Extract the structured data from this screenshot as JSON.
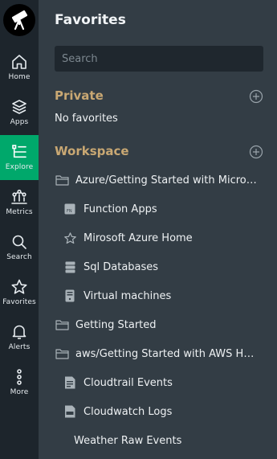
{
  "nav": {
    "items": [
      {
        "label": "Home",
        "icon": "home-icon"
      },
      {
        "label": "Apps",
        "icon": "apps-icon"
      },
      {
        "label": "Explore",
        "icon": "explore-icon",
        "active": true
      },
      {
        "label": "Metrics",
        "icon": "metrics-icon"
      },
      {
        "label": "Search",
        "icon": "search-icon"
      },
      {
        "label": "Favorites",
        "icon": "star-icon"
      },
      {
        "label": "Alerts",
        "icon": "bell-icon"
      },
      {
        "label": "More",
        "icon": "more-icon"
      }
    ]
  },
  "panel": {
    "title": "Favorites",
    "search_placeholder": "Search",
    "private": {
      "label": "Private",
      "empty_text": "No favorites"
    },
    "workspace": {
      "label": "Workspace",
      "items": [
        {
          "label": "Azure/Getting Started with Microsoft Azure",
          "icon": "folder-icon"
        },
        {
          "label": "Function Apps",
          "icon": "fn-dashboard-icon"
        },
        {
          "label": "Mirosoft Azure Home",
          "icon": "star-outline-icon"
        },
        {
          "label": "Sql Databases",
          "icon": "database-icon"
        },
        {
          "label": "Virtual machines",
          "icon": "server-icon"
        },
        {
          "label": "Getting Started",
          "icon": "folder-icon"
        },
        {
          "label": "aws/Getting Started with AWS Health",
          "icon": "folder-icon"
        },
        {
          "label": "Cloudtrail Events",
          "icon": "log-document-icon"
        },
        {
          "label": "Cloudwatch Logs",
          "icon": "json-document-icon"
        },
        {
          "label": "Weather Raw Events",
          "icon": ""
        }
      ]
    }
  },
  "colors": {
    "rail_bg": "#1d252c",
    "panel_bg": "#333d45",
    "active_nav": "#00a86b",
    "section_header": "#c9a873",
    "search_bg": "#1f272e"
  }
}
